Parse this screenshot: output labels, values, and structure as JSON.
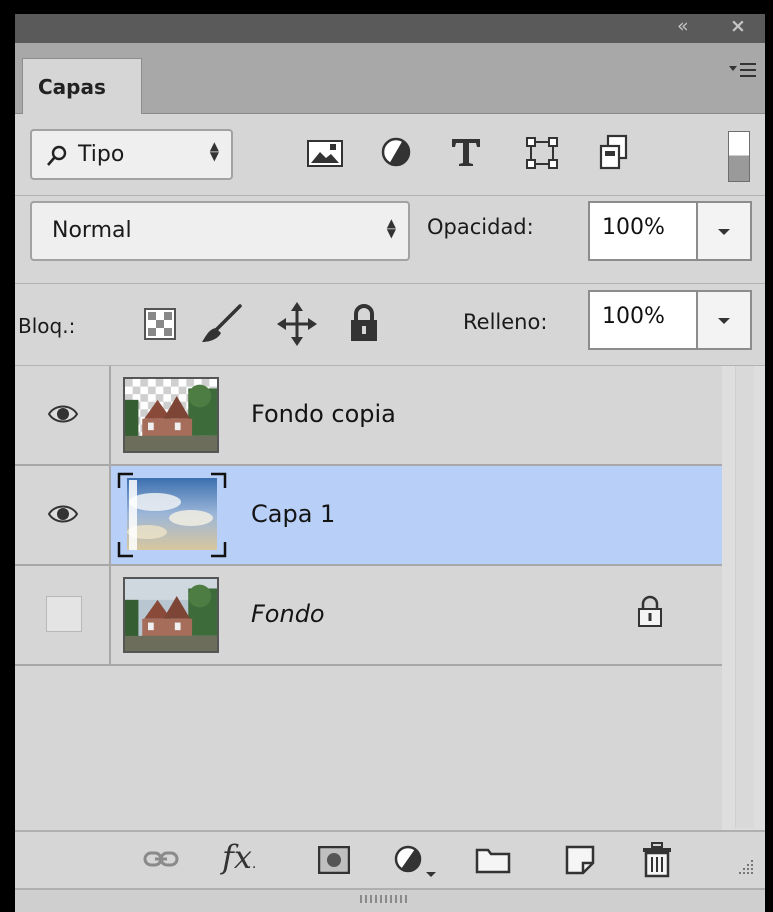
{
  "panel": {
    "tab_label": "Capas",
    "collapse_icon": "double-chevron-left-icon",
    "close_icon": "close-icon",
    "menu_icon": "panel-menu-icon"
  },
  "filter": {
    "kind_label": "Tipo",
    "kind_icon": "search-icon",
    "filter_icons": [
      "image-filter-icon",
      "adjustment-filter-icon",
      "type-filter-icon",
      "shape-filter-icon",
      "smart-object-filter-icon"
    ],
    "toggle_icon": "filter-toggle-icon"
  },
  "blend": {
    "mode": "Normal",
    "opacity_label": "Opacidad:",
    "opacity_value": "100%"
  },
  "lock": {
    "label": "Bloq.:",
    "icons": [
      "lock-transparent-pixels-icon",
      "lock-image-pixels-icon",
      "lock-position-icon",
      "lock-all-icon"
    ],
    "fill_label": "Relleno:",
    "fill_value": "100%"
  },
  "layers": [
    {
      "name": "Fondo copia",
      "visible": true,
      "selected": false,
      "locked": false,
      "italic": false
    },
    {
      "name": "Capa 1",
      "visible": true,
      "selected": true,
      "locked": false,
      "italic": false
    },
    {
      "name": "Fondo",
      "visible": false,
      "selected": false,
      "locked": true,
      "italic": true
    }
  ],
  "footer": {
    "icons": [
      "link-layers-icon",
      "layer-style-fx-icon",
      "layer-mask-icon",
      "adjustment-layer-icon",
      "new-group-icon",
      "new-layer-icon",
      "delete-layer-icon"
    ]
  },
  "colors": {
    "panel_bg": "#d6d6d6",
    "selected_row": "#b8cff7",
    "titlebar": "#5a5a5a"
  }
}
